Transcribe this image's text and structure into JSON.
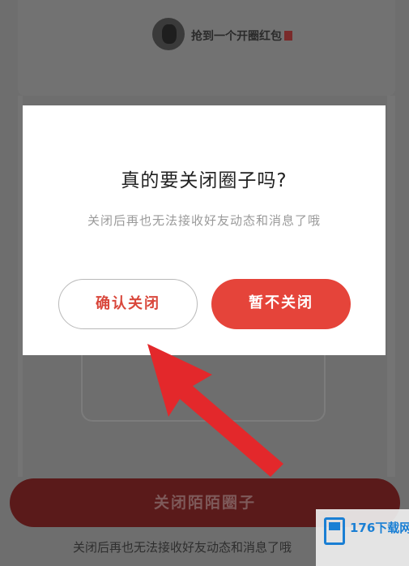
{
  "background": {
    "header_text": "抢到一个开圈红包",
    "big_button_label": "关闭陌陌圈子",
    "bottom_text": "关闭后再也无法接收好友动态和消息了哦"
  },
  "dialog": {
    "title": "真的要关闭圈子吗?",
    "message": "关闭后再也无法接收好友动态和消息了哦",
    "confirm_label": "确认关闭",
    "cancel_label": "暂不关闭"
  },
  "watermark": {
    "text": "176下载网"
  },
  "colors": {
    "accent": "#e5443a",
    "arrow": "#e3282b",
    "overlay": "#6e6e6e"
  }
}
